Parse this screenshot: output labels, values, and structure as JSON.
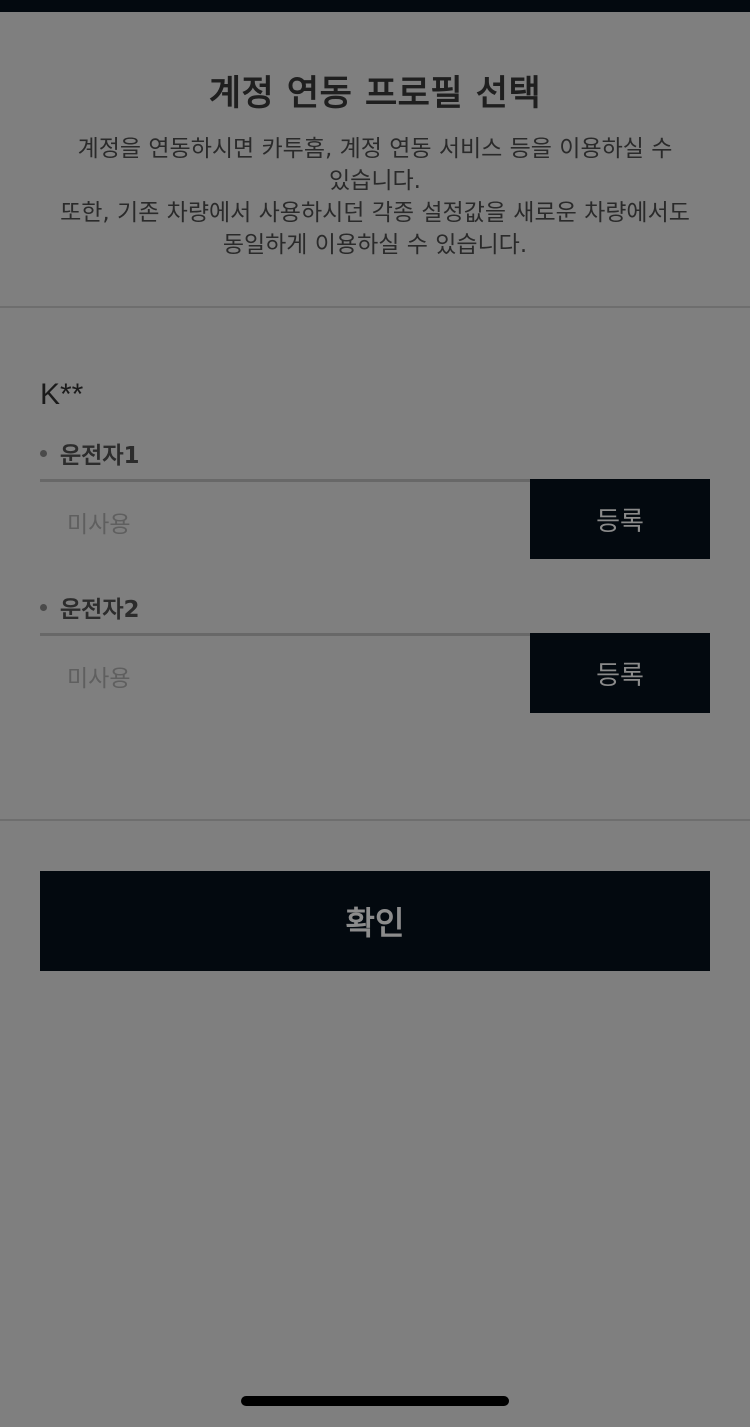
{
  "header": {
    "title": "계정 연동 프로필 선택",
    "description_lines": [
      "계정을 연동하시면 카투홈, 계정 연동 서비스 등을 이용하실 수",
      "있습니다.",
      "또한, 기존 차량에서 사용하시던 각종 설정값을 새로운 차량에서도",
      "동일하게 이용하실 수 있습니다."
    ]
  },
  "account": {
    "name": "K**"
  },
  "drivers": [
    {
      "label": "운전자1",
      "value": "미사용",
      "button_label": "등록"
    },
    {
      "label": "운전자2",
      "value": "미사용",
      "button_label": "등록"
    }
  ],
  "confirm_label": "확인",
  "colors": {
    "overlay_background": "#7f7f7f",
    "dark_button": "#03090f"
  }
}
